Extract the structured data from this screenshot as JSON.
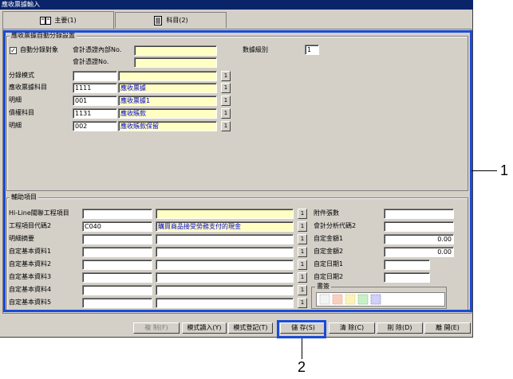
{
  "window": {
    "title": "應收票據輸入"
  },
  "tabs": [
    {
      "label": "主要(1)",
      "icon": "book-icon"
    },
    {
      "label": "科目(2)",
      "icon": "ledger-icon"
    }
  ],
  "auto_section": {
    "legend": "應收票據自動分錄設置",
    "checkbox_label": "自動分錄對象",
    "checkbox_checked": "✓",
    "internal_no_label": "會計憑證內部No.",
    "internal_no_value": "",
    "voucher_no_label": "會計憑證No.",
    "voucher_no_value": "",
    "data_level_label": "數據級別",
    "data_level_value": "1",
    "pattern_label": "分錄模式",
    "pattern_code": "",
    "pattern_name": "",
    "rows": [
      {
        "label": "應收票據科目",
        "code": "1111",
        "name": "應收票據"
      },
      {
        "label": "明細",
        "code": "001",
        "name": "應收票據1"
      },
      {
        "label": "債權科目",
        "code": "1131",
        "name": "應收賬款"
      },
      {
        "label": "明細",
        "code": "002",
        "name": "應收賬款保留"
      }
    ],
    "lookup_label": "1"
  },
  "aux_section": {
    "legend": "輔助項目",
    "rows": [
      {
        "label": "Hi-Line關聯工程項目",
        "code": "",
        "name": ""
      },
      {
        "label": "工程項目代碼2",
        "code": "C040",
        "name": "購買商品接受勞務支付的現金"
      },
      {
        "label": "明細摘要",
        "code": "",
        "name": ""
      },
      {
        "label": "自定基本資料1",
        "code": "",
        "name": ""
      },
      {
        "label": "自定基本資料2",
        "code": "",
        "name": ""
      },
      {
        "label": "自定基本資料3",
        "code": "",
        "name": ""
      },
      {
        "label": "自定基本資料4",
        "code": "",
        "name": ""
      },
      {
        "label": "自定基本資料5",
        "code": "",
        "name": ""
      }
    ],
    "right_fields": [
      {
        "label": "附件張數",
        "value": ""
      },
      {
        "label": "會計分析代碼2",
        "value": ""
      },
      {
        "label": "自定金額1",
        "value": "0.00"
      },
      {
        "label": "自定金額2",
        "value": "0.00"
      },
      {
        "label": "自定日期1",
        "value": ""
      },
      {
        "label": "自定日期2",
        "value": ""
      }
    ],
    "signature_label": "書簽",
    "lookup_label": "1"
  },
  "buttons": {
    "copy": "複 制(F)",
    "pattern_import": "模式讀入(Y)",
    "pattern_register": "模式登記(T)",
    "save": "儲 存(S)",
    "clear": "清 除(C)",
    "delete": "削 除(D)",
    "exit": "離 開(E)"
  },
  "callouts": {
    "one": "1",
    "two": "2"
  },
  "colors": {
    "accent": "#1a4bd8",
    "title_bar": "#0a246a",
    "required": "#ffffc4"
  }
}
